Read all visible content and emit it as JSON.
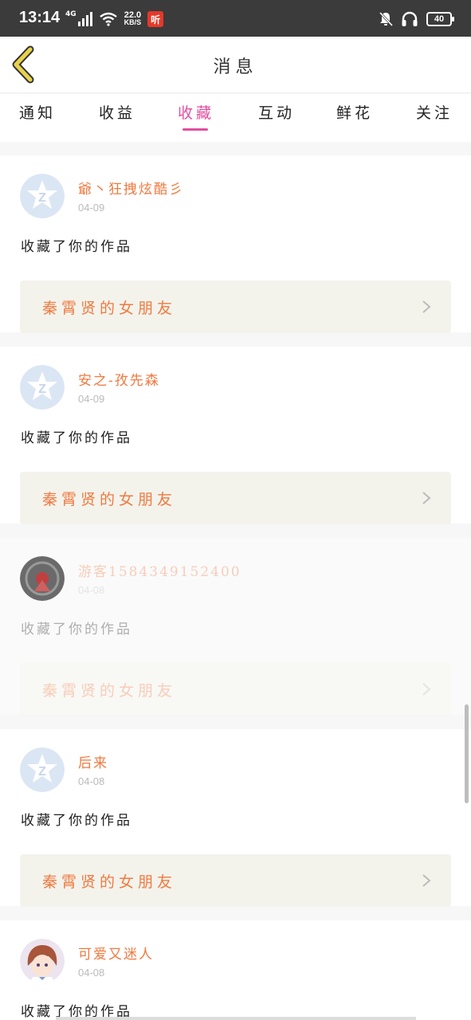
{
  "status_bar": {
    "time": "13:14",
    "network": "4G",
    "speed_value": "22.0",
    "speed_unit": "KB/S",
    "app_badge": "听",
    "battery": "40"
  },
  "header": {
    "title": "消息"
  },
  "tabs": [
    {
      "label": "通知"
    },
    {
      "label": "收益"
    },
    {
      "label": "收藏",
      "active": true
    },
    {
      "label": "互动"
    },
    {
      "label": "鲜花"
    },
    {
      "label": "关注"
    }
  ],
  "messages": [
    {
      "user": "爺丶狂拽炫酷彡",
      "date": "04-09",
      "action": "收藏了你的作品",
      "work": "秦霄贤的女朋友",
      "avatar": "default-avatar-icon"
    },
    {
      "user": "安之-孜先森",
      "date": "04-09",
      "action": "收藏了你的作品",
      "work": "秦霄贤的女朋友",
      "avatar": "default-avatar-icon"
    },
    {
      "user": "游客1584349152400",
      "date": "04-08",
      "action": "收藏了你的作品",
      "work": "秦霄贤的女朋友",
      "avatar": "dark-round-avatar"
    },
    {
      "user": "后来",
      "date": "04-08",
      "action": "收藏了你的作品",
      "work": "秦霄贤的女朋友",
      "avatar": "default-avatar-icon"
    },
    {
      "user": "可爱又迷人",
      "date": "04-08",
      "action": "收藏了你的作品",
      "work": "",
      "avatar": "anime-girl-avatar"
    }
  ],
  "colors": {
    "accent_pink": "#e24fa0",
    "accent_orange": "#f07a40",
    "back_arrow": "#e8d24a"
  }
}
